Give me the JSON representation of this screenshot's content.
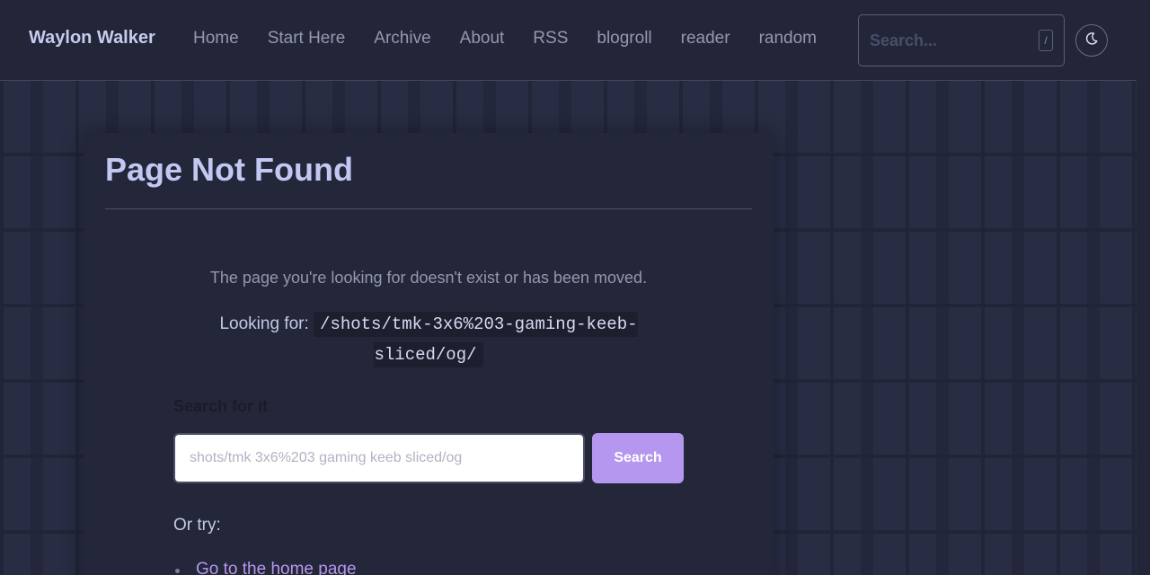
{
  "header": {
    "brand": "Waylon Walker",
    "nav": [
      "Home",
      "Start Here",
      "Archive",
      "About",
      "RSS",
      "blogroll",
      "reader",
      "random"
    ],
    "search_placeholder": "Search...",
    "search_shortcut": "/",
    "theme_toggle_icon": "moon-icon"
  },
  "main": {
    "title": "Page Not Found",
    "message": "The page you're looking for doesn't exist or has been moved.",
    "looking_for_label": "Looking for:",
    "looking_for_path": "/shots/tmk-3x6%203-gaming-keeb-sliced/og/",
    "search_label": "Search for it",
    "search_input_placeholder": "shots/tmk 3x6%203 gaming keeb sliced/og",
    "search_button": "Search",
    "or_try": "Or try:",
    "suggestions": [
      "Go to the home page"
    ]
  },
  "colors": {
    "accent": "#b597ef",
    "heading": "#c3c8f2",
    "background": "#232639"
  }
}
